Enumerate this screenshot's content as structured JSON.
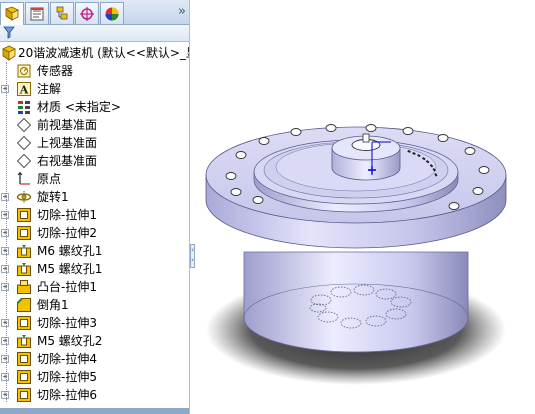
{
  "tabs": [
    {
      "name": "feature-manager",
      "icon": "feature-tree-icon"
    },
    {
      "name": "property-manager",
      "icon": "property-icon"
    },
    {
      "name": "configuration-manager",
      "icon": "configuration-icon"
    },
    {
      "name": "dimxpert-manager",
      "icon": "dimxpert-icon"
    },
    {
      "name": "display-manager",
      "icon": "appearance-icon"
    }
  ],
  "tabbar": {
    "more": "»"
  },
  "tree": {
    "root": "20谐波减速机  (默认<<默认>_显",
    "items": [
      {
        "label": "传感器",
        "icon": "sensor-icon",
        "expander": false
      },
      {
        "label": "注解",
        "icon": "annotation-icon",
        "expander": true
      },
      {
        "label": "材质 <未指定>",
        "icon": "material-icon",
        "expander": false
      },
      {
        "label": "前视基准面",
        "icon": "plane-icon",
        "expander": false
      },
      {
        "label": "上视基准面",
        "icon": "plane-icon",
        "expander": false
      },
      {
        "label": "右视基准面",
        "icon": "plane-icon",
        "expander": false
      },
      {
        "label": "原点",
        "icon": "origin-icon",
        "expander": false
      },
      {
        "label": "旋转1",
        "icon": "revolve-icon",
        "expander": true
      },
      {
        "label": "切除-拉伸1",
        "icon": "cut-extrude-icon",
        "expander": true
      },
      {
        "label": "切除-拉伸2",
        "icon": "cut-extrude-icon",
        "expander": true
      },
      {
        "label": "M6 螺纹孔1",
        "icon": "hole-wizard-icon",
        "expander": true
      },
      {
        "label": "M5 螺纹孔1",
        "icon": "hole-wizard-icon",
        "expander": true
      },
      {
        "label": "凸台-拉伸1",
        "icon": "boss-extrude-icon",
        "expander": true
      },
      {
        "label": "倒角1",
        "icon": "chamfer-icon",
        "expander": false
      },
      {
        "label": "切除-拉伸3",
        "icon": "cut-extrude-icon",
        "expander": true
      },
      {
        "label": "M5 螺纹孔2",
        "icon": "hole-wizard-icon",
        "expander": true
      },
      {
        "label": "切除-拉伸4",
        "icon": "cut-extrude-icon",
        "expander": true
      },
      {
        "label": "切除-拉伸5",
        "icon": "cut-extrude-icon",
        "expander": true
      },
      {
        "label": "切除-拉伸6",
        "icon": "cut-extrude-icon",
        "expander": true
      }
    ]
  },
  "colors": {
    "part_body": "#c8c8ee",
    "part_shadow": "#8a8ab4",
    "feature_icon": "#f2c200",
    "selection_blue": "#0000cc"
  }
}
